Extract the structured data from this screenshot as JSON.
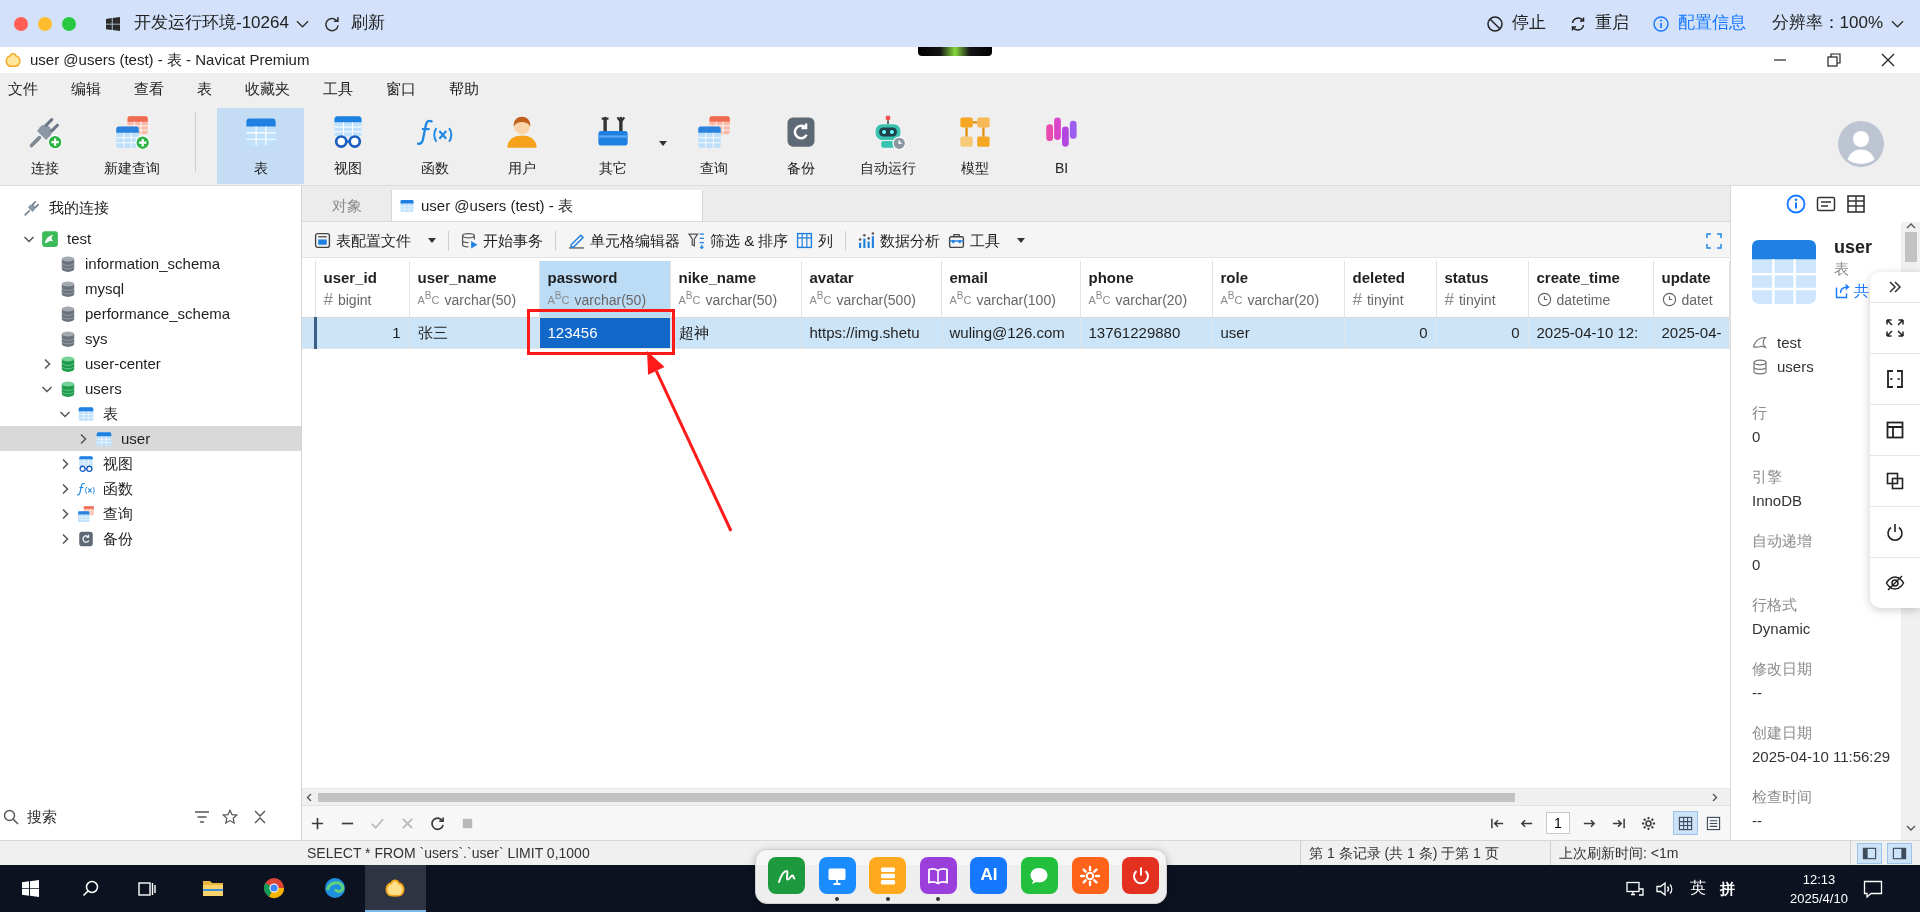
{
  "remote_bar": {
    "environment": "开发运行环境-10264",
    "refresh": "刷新",
    "actions": [
      {
        "kind": "stop",
        "label": "停止"
      },
      {
        "kind": "restart",
        "label": "重启"
      },
      {
        "kind": "info",
        "label": "配置信息"
      }
    ],
    "resolution": "分辨率：100%"
  },
  "window": {
    "title": "user @users (test) - 表 - Navicat Premium"
  },
  "menu": [
    "文件",
    "编辑",
    "查看",
    "表",
    "收藏夹",
    "工具",
    "窗口",
    "帮助"
  ],
  "toolbar": [
    {
      "kind": "connect",
      "label": "连接",
      "selected": false,
      "dropdown": false,
      "separator_after": false
    },
    {
      "kind": "new_query",
      "label": "新建查询",
      "selected": false,
      "dropdown": false,
      "separator_after": true
    },
    {
      "kind": "table",
      "label": "表",
      "selected": true,
      "dropdown": false,
      "separator_after": false
    },
    {
      "kind": "view",
      "label": "视图",
      "selected": false,
      "dropdown": false,
      "separator_after": false
    },
    {
      "kind": "function",
      "label": "函数",
      "selected": false,
      "dropdown": false,
      "separator_after": false
    },
    {
      "kind": "user",
      "label": "用户",
      "selected": false,
      "dropdown": false,
      "separator_after": false
    },
    {
      "kind": "other",
      "label": "其它",
      "selected": false,
      "dropdown": true,
      "separator_after": false
    },
    {
      "kind": "query",
      "label": "查询",
      "selected": false,
      "dropdown": false,
      "separator_after": false
    },
    {
      "kind": "backup",
      "label": "备份",
      "selected": false,
      "dropdown": false,
      "separator_after": false
    },
    {
      "kind": "automation",
      "label": "自动运行",
      "selected": false,
      "dropdown": false,
      "separator_after": false
    },
    {
      "kind": "model",
      "label": "模型",
      "selected": false,
      "dropdown": false,
      "separator_after": false
    },
    {
      "kind": "bi",
      "label": "BI",
      "selected": false,
      "dropdown": false,
      "separator_after": false
    }
  ],
  "sidebar": {
    "tree": [
      {
        "kind": "group",
        "label": "我的连接",
        "selected": false,
        "children": [
          {
            "kind": "connection",
            "label": "test",
            "expanded": true,
            "selected": false,
            "children": [
              {
                "kind": "database",
                "label": "information_schema",
                "opened": false,
                "selected": false
              },
              {
                "kind": "database",
                "label": "mysql",
                "opened": false,
                "selected": false
              },
              {
                "kind": "database",
                "label": "performance_schema",
                "opened": false,
                "selected": false
              },
              {
                "kind": "database",
                "label": "sys",
                "opened": false,
                "selected": false
              },
              {
                "kind": "database",
                "label": "user-center",
                "opened": true,
                "expanded": false,
                "selected": false
              },
              {
                "kind": "database",
                "label": "users",
                "opened": true,
                "expanded": true,
                "selected": false,
                "children": [
                  {
                    "kind": "tables",
                    "label": "表",
                    "expanded": true,
                    "selected": false,
                    "children": [
                      {
                        "kind": "table",
                        "label": "user",
                        "expanded": false,
                        "selected": true
                      }
                    ]
                  },
                  {
                    "kind": "views",
                    "label": "视图",
                    "expanded": false,
                    "selected": false
                  },
                  {
                    "kind": "functions",
                    "label": "函数",
                    "expanded": false,
                    "selected": false
                  },
                  {
                    "kind": "queries",
                    "label": "查询",
                    "expanded": false,
                    "selected": false
                  },
                  {
                    "kind": "backups",
                    "label": "备份",
                    "expanded": false,
                    "selected": false
                  }
                ]
              }
            ]
          }
        ]
      }
    ],
    "search": {
      "placeholder": "搜索"
    }
  },
  "tabs": [
    {
      "kind": "objects",
      "label": "对象",
      "selected": false
    },
    {
      "kind": "table",
      "label": "user @users (test) - 表",
      "selected": true
    }
  ],
  "table_toolbar": [
    {
      "kind": "profile",
      "label": "表配置文件",
      "dropdown": true,
      "separator_after": true
    },
    {
      "kind": "transaction",
      "label": "开始事务",
      "dropdown": false,
      "separator_after": true
    },
    {
      "kind": "cell_editor",
      "label": "单元格编辑器",
      "dropdown": false,
      "separator_after": false
    },
    {
      "kind": "filter",
      "label": "筛选 & 排序",
      "dropdown": false,
      "separator_after": false
    },
    {
      "kind": "columns",
      "label": "列",
      "dropdown": false,
      "separator_after": true
    },
    {
      "kind": "analysis",
      "label": "数据分析",
      "dropdown": false,
      "separator_after": false
    },
    {
      "kind": "tools",
      "label": "工具",
      "dropdown": true,
      "separator_after": false
    }
  ],
  "grid": {
    "columns": [
      {
        "name": "user_id",
        "type": "bigint",
        "kind": "number",
        "mark": "#",
        "selected": false
      },
      {
        "name": "user_name",
        "type": "varchar(50)",
        "kind": "text",
        "mark": "A$^{B}$C",
        "selected": false
      },
      {
        "name": "password",
        "type": "varchar(50)",
        "kind": "text",
        "mark": "A$^{B}$C",
        "selected": true
      },
      {
        "name": "nike_name",
        "type": "varchar(50)",
        "kind": "text",
        "mark": "A$^{B}$C",
        "selected": false
      },
      {
        "name": "avatar",
        "type": "varchar(500)",
        "kind": "text",
        "mark": "A$^{B}$C",
        "selected": false
      },
      {
        "name": "email",
        "type": "varchar(100)",
        "kind": "text",
        "mark": "A$^{B}$C",
        "selected": false
      },
      {
        "name": "phone",
        "type": "varchar(20)",
        "kind": "text",
        "mark": "A$^{B}$C",
        "selected": false
      },
      {
        "name": "role",
        "type": "varchar(20)",
        "kind": "text",
        "mark": "A$^{B}$C",
        "selected": false
      },
      {
        "name": "deleted",
        "type": "tinyint",
        "kind": "number",
        "mark": "#",
        "selected": false
      },
      {
        "name": "status",
        "type": "tinyint",
        "kind": "number",
        "mark": "#",
        "selected": false
      },
      {
        "name": "create_time",
        "type": "datetime",
        "kind": "datetime",
        "selected": false
      },
      {
        "name": "update",
        "type": "datet",
        "kind": "datetime",
        "selected": false
      }
    ],
    "rows": [
      {
        "selected": true,
        "cells": [
          {
            "value": "1",
            "selected": false
          },
          {
            "value": "张三",
            "selected": false
          },
          {
            "value": "123456",
            "selected": true
          },
          {
            "value": "超神",
            "selected": false
          },
          {
            "value": "https://img.shetu",
            "selected": false
          },
          {
            "value": "wuling@126.com",
            "selected": false
          },
          {
            "value": "13761229880",
            "selected": false
          },
          {
            "value": "user",
            "selected": false
          },
          {
            "value": "0",
            "selected": false
          },
          {
            "value": "0",
            "selected": false
          },
          {
            "value": "2025-04-10 12:",
            "selected": false
          },
          {
            "value": "2025-04-",
            "selected": false
          }
        ]
      }
    ],
    "annotations": {
      "frame": true,
      "arrow": true
    }
  },
  "grid_footer": {
    "actions": [
      {
        "kind": "add",
        "disabled": false
      },
      {
        "kind": "delete",
        "disabled": false
      },
      {
        "kind": "apply",
        "disabled": true
      },
      {
        "kind": "discard",
        "disabled": true
      },
      {
        "kind": "refresh",
        "disabled": false
      },
      {
        "kind": "stop",
        "disabled": true
      }
    ],
    "page": "1",
    "views": [
      {
        "kind": "grid",
        "selected": true
      },
      {
        "kind": "form",
        "selected": false
      }
    ]
  },
  "details": {
    "tabs": [
      {
        "kind": "info",
        "selected": true
      },
      {
        "kind": "ddl",
        "selected": false
      },
      {
        "kind": "preview",
        "selected": false
      }
    ],
    "name": "user",
    "type": "表",
    "share": "共",
    "connection": "test",
    "database": "users",
    "properties": [
      {
        "label": "行",
        "value": "0"
      },
      {
        "label": "引擎",
        "value": "InnoDB"
      },
      {
        "label": "自动递增",
        "value": "0"
      },
      {
        "label": "行格式",
        "value": "Dynamic"
      },
      {
        "label": "修改日期",
        "value": "--"
      },
      {
        "label": "创建日期",
        "value": "2025-04-10 11:56:29"
      },
      {
        "label": "检查时间",
        "value": "--"
      }
    ]
  },
  "status_bar": {
    "query": "SELECT * FROM `users`.`user` LIMIT 0,1000",
    "record": "第 1 条记录 (共 1 条) 于第 1 页",
    "refreshed": "上次刷新时间: <1m",
    "panes": [
      {
        "kind": "left",
        "selected": true
      },
      {
        "kind": "right",
        "selected": true
      }
    ]
  },
  "taskbar": {
    "apps": [
      {
        "kind": "folder",
        "selected": false
      },
      {
        "kind": "round_browser",
        "selected": false
      },
      {
        "kind": "swirl_browser",
        "selected": false
      },
      {
        "kind": "logo_app",
        "selected": true
      }
    ],
    "dock": [
      {
        "kind": "signature",
        "color": "#1e9a3e",
        "running": false
      },
      {
        "kind": "monitor",
        "color": "#1a8cff",
        "running": true
      },
      {
        "kind": "server",
        "color": "#ffa91f",
        "running": true
      },
      {
        "kind": "book",
        "color": "#9a3fdc",
        "running": true
      },
      {
        "kind": "label",
        "label": "AI",
        "color": "#1677ff",
        "running": false
      },
      {
        "kind": "chat",
        "color": "#22c03c",
        "running": false
      },
      {
        "kind": "gear",
        "color": "#ff6319",
        "running": false
      },
      {
        "kind": "power",
        "color": "#e3301f",
        "running": false
      }
    ],
    "ime": "英",
    "ime_mode": "拼",
    "time": "12:13",
    "date": "2025/4/10"
  }
}
